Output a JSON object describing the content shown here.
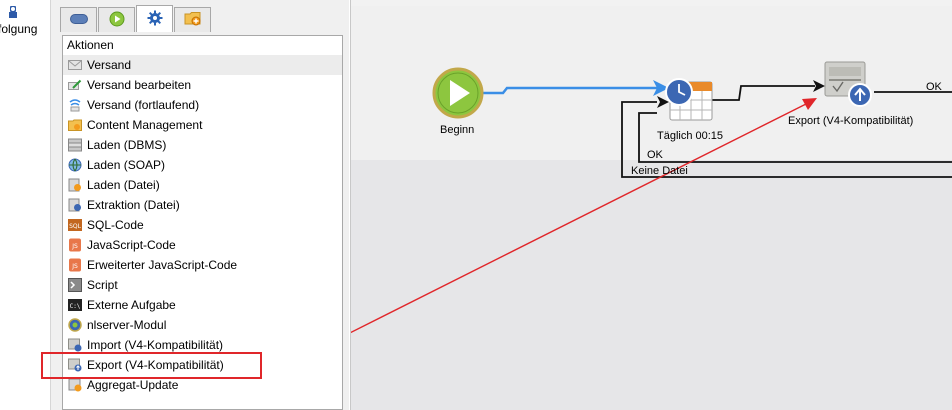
{
  "nav": {
    "label": "folgung",
    "icon": "user-icon"
  },
  "tabs": [
    {
      "icon": "pill-icon"
    },
    {
      "icon": "play-icon"
    },
    {
      "icon": "gear-icon",
      "active": true
    },
    {
      "icon": "folder-add-icon"
    }
  ],
  "list": {
    "header": "Aktionen",
    "items": [
      {
        "label": "Versand",
        "icon": "envelope-icon",
        "selected": true
      },
      {
        "label": "Versand bearbeiten",
        "icon": "envelope-edit-icon"
      },
      {
        "label": "Versand (fortlaufend)",
        "icon": "recurring-delivery-icon"
      },
      {
        "label": "Content Management",
        "icon": "content-folder-icon"
      },
      {
        "label": "Laden (DBMS)",
        "icon": "database-icon"
      },
      {
        "label": "Laden (SOAP)",
        "icon": "globe-icon"
      },
      {
        "label": "Laden (Datei)",
        "icon": "file-load-icon"
      },
      {
        "label": "Extraktion (Datei)",
        "icon": "file-extract-icon"
      },
      {
        "label": "SQL-Code",
        "icon": "sql-icon"
      },
      {
        "label": "JavaScript-Code",
        "icon": "javascript-icon"
      },
      {
        "label": "Erweiterter JavaScript-Code",
        "icon": "javascript-advanced-icon"
      },
      {
        "label": "Script",
        "icon": "script-icon"
      },
      {
        "label": "Externe Aufgabe",
        "icon": "terminal-icon"
      },
      {
        "label": "nlserver-Modul",
        "icon": "module-icon"
      },
      {
        "label": "Import (V4-Kompatibilität)",
        "icon": "import-icon"
      },
      {
        "label": "Export (V4-Kompatibilität)",
        "icon": "export-icon"
      },
      {
        "label": "Aggregat-Update",
        "icon": "aggregate-icon"
      }
    ]
  },
  "workflow": {
    "nodes": {
      "start": {
        "label": "Beginn",
        "icon": "start-play-icon"
      },
      "scheduler": {
        "label": "Täglich 00:15",
        "icon": "scheduler-icon"
      },
      "export": {
        "label": "Export (V4-Kompatibilität)",
        "icon": "export-node-icon"
      }
    },
    "transitions": {
      "export_ok": "OK",
      "scheduler_ok": "OK",
      "no_file": "Keine Datei"
    }
  },
  "colors": {
    "highlight": "#e0262a",
    "link_blue": "#3a8ee6",
    "start_green": "#8dc63f"
  }
}
